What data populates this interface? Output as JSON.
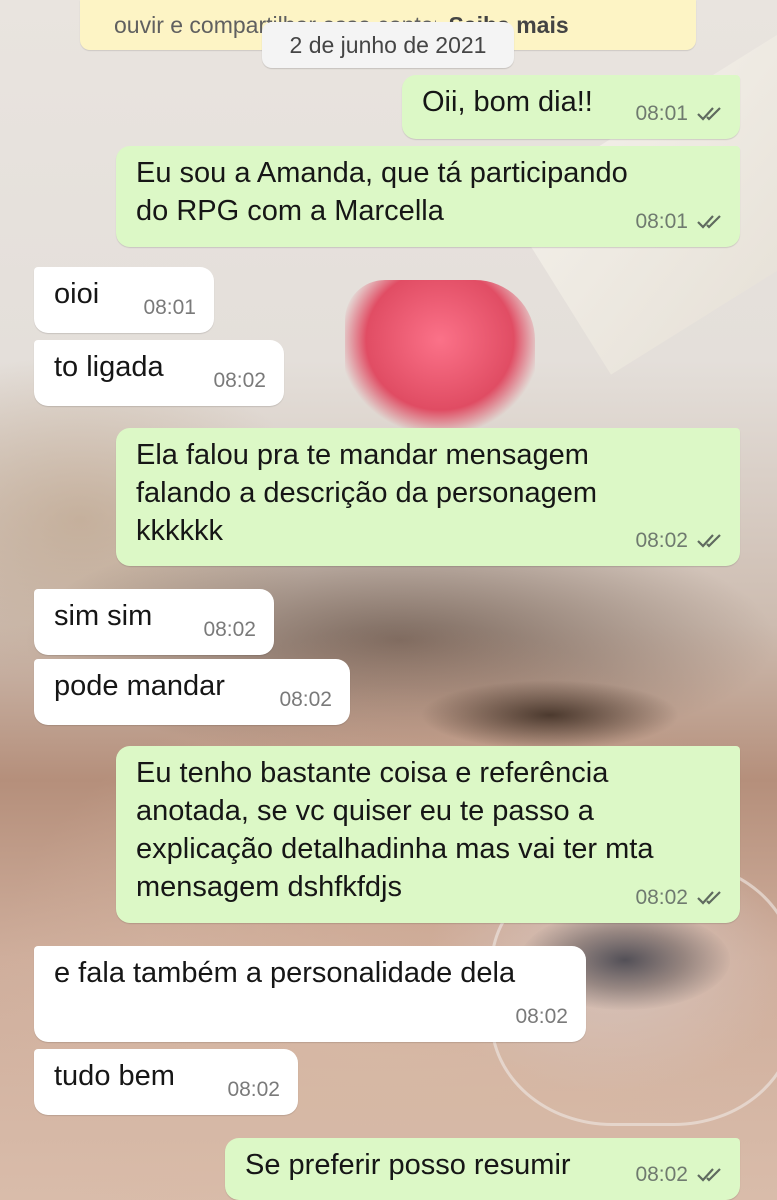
{
  "banner": {
    "text_start": "ouvir e comp",
    "text_middle": "artilhar esse conteúdo",
    "text_end": ". ",
    "link": "Saiba mais"
  },
  "date_label": "2 de junho de 2021",
  "messages": [
    {
      "direction": "out",
      "lines": [
        "Oii, bom dia!!"
      ],
      "time": "08:01",
      "status": "read"
    },
    {
      "direction": "out",
      "lines": [
        "Eu sou a Amanda, que tá participando",
        "do RPG com a Marcella"
      ],
      "time": "08:01",
      "status": "read"
    },
    {
      "direction": "in",
      "lines": [
        "oioi"
      ],
      "time": "08:01"
    },
    {
      "direction": "in",
      "lines": [
        "to ligada"
      ],
      "time": "08:02"
    },
    {
      "direction": "out",
      "lines": [
        "Ela falou pra te mandar mensagem",
        "falando a descrição da personagem",
        "kkkkkk"
      ],
      "time": "08:02",
      "status": "read"
    },
    {
      "direction": "in",
      "lines": [
        "sim sim"
      ],
      "time": "08:02"
    },
    {
      "direction": "in",
      "lines": [
        "pode mandar"
      ],
      "time": "08:02"
    },
    {
      "direction": "out",
      "lines": [
        "Eu tenho bastante coisa e referência",
        "anotada, se vc quiser eu te passo a",
        "explicação detalhadinha mas vai ter mta",
        "mensagem dshfkfdjs"
      ],
      "time": "08:02",
      "status": "read"
    },
    {
      "direction": "in",
      "lines": [
        "e fala também a personalidade dela"
      ],
      "time": "08:02"
    },
    {
      "direction": "in",
      "lines": [
        "tudo bem"
      ],
      "time": "08:02"
    },
    {
      "direction": "out",
      "lines": [
        "Se preferir posso resumir"
      ],
      "time": "08:02",
      "status": "read"
    }
  ],
  "colors": {
    "outgoing_bubble": "#dcf8c6",
    "incoming_bubble": "#ffffff",
    "banner_bg": "#fdf4c5",
    "read_ticks": "#5f6a5f"
  },
  "icons": {
    "read_receipt": "double-check-icon"
  }
}
